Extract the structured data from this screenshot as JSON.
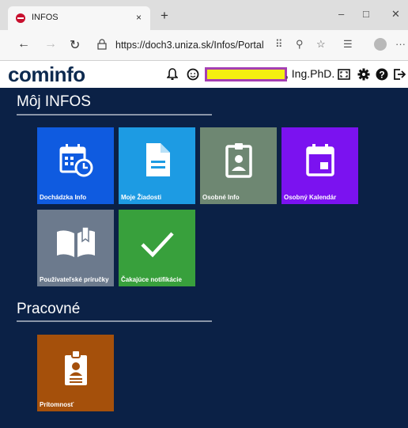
{
  "browser": {
    "tab_title": "INFOS",
    "tab_close": "×",
    "new_tab": "+",
    "minimize": "–",
    "maximize": "□",
    "close": "✕",
    "url": "https://doch3.uniza.sk/Infos/Portal",
    "more": "···"
  },
  "header": {
    "logo": "cominfo",
    "user_suffix": ", Ing.PhD."
  },
  "sections": [
    {
      "title": "Môj INFOS",
      "tiles": [
        {
          "label": "Dochádzka Info",
          "color": "#0f5be0",
          "icon": "calendar-clock-icon"
        },
        {
          "label": "Moje Žiadosti",
          "color": "#1d9be3",
          "icon": "document-icon"
        },
        {
          "label": "Osobné Info",
          "color": "#6e8772",
          "icon": "id-badge-icon"
        },
        {
          "label": "Osobný Kalendár",
          "color": "#7b12f0",
          "icon": "calendar-icon"
        },
        {
          "label": "Používateľské príručky",
          "color": "#6c7a8d",
          "icon": "book-icon"
        },
        {
          "label": "Čakajúce notifikácie",
          "color": "#38a03c",
          "icon": "checkmark-icon"
        }
      ]
    },
    {
      "title": "Pracovné",
      "tiles": [
        {
          "label": "Prítomnosť",
          "color": "#a5500b",
          "icon": "clipboard-badge-icon"
        }
      ]
    }
  ]
}
